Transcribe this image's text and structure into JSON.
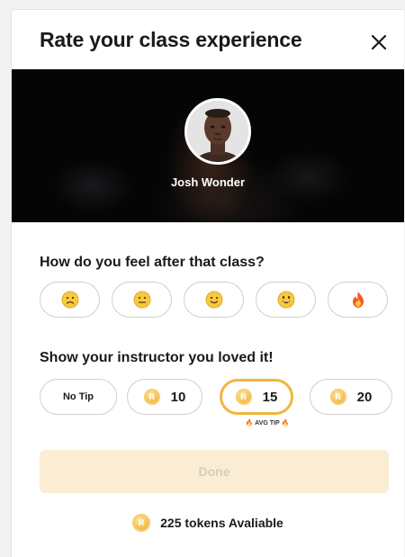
{
  "dialog": {
    "title": "Rate your class experience"
  },
  "instructor": {
    "name": "Josh Wonder"
  },
  "feeling": {
    "question": "How do you feel after that class?",
    "options": [
      {
        "emoji": "🙁",
        "icon": "frowning-face-icon"
      },
      {
        "emoji": "😐",
        "icon": "neutral-face-icon"
      },
      {
        "emoji": "🙂",
        "icon": "slightly-smiling-face-icon"
      },
      {
        "emoji": "😃",
        "icon": "grinning-face-icon"
      },
      {
        "emoji": "🔥",
        "icon": "fire-icon"
      }
    ]
  },
  "tip": {
    "heading": "Show your instructor you loved it!",
    "no_tip_label": "No Tip",
    "coin_letter": "R",
    "amounts": [
      "10",
      "15",
      "20"
    ],
    "selected_amount": "15",
    "avg_tip_label": "🔥 AVG TIP 🔥"
  },
  "actions": {
    "done_label": "Done"
  },
  "balance": {
    "text": "225 tokens Avaliable"
  },
  "colors": {
    "accent": "#f2b53f",
    "done_bg": "#fbedd4",
    "done_text": "#d8cdb9",
    "hero_bg": "#050506"
  }
}
